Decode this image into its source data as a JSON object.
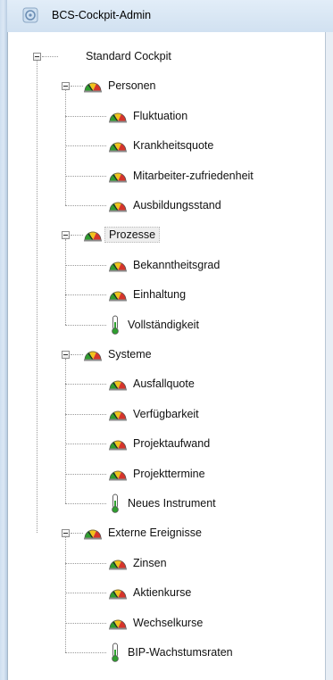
{
  "window": {
    "title": "BCS-Cockpit-Admin"
  },
  "tree": {
    "root": {
      "label": "Standard Cockpit",
      "icon": "none"
    },
    "groups": [
      {
        "label": "Personen",
        "icon": "gauge-icon",
        "items": [
          {
            "label": "Fluktuation",
            "icon": "gauge-icon"
          },
          {
            "label": "Krankheitsquote",
            "icon": "gauge-icon"
          },
          {
            "label": "Mitarbeiter-zufriedenheit",
            "icon": "gauge-icon"
          },
          {
            "label": "Ausbildungsstand",
            "icon": "gauge-icon"
          }
        ]
      },
      {
        "label": "Prozesse",
        "icon": "gauge-icon",
        "selected": true,
        "items": [
          {
            "label": "Bekanntheitsgrad",
            "icon": "gauge-icon"
          },
          {
            "label": "Einhaltung",
            "icon": "gauge-icon"
          },
          {
            "label": "Vollständigkeit",
            "icon": "thermometer-icon"
          }
        ]
      },
      {
        "label": "Systeme",
        "icon": "gauge-icon",
        "items": [
          {
            "label": "Ausfallquote",
            "icon": "gauge-icon"
          },
          {
            "label": "Verfügbarkeit",
            "icon": "gauge-icon"
          },
          {
            "label": "Projektaufwand",
            "icon": "gauge-icon"
          },
          {
            "label": "Projekttermine",
            "icon": "gauge-icon"
          },
          {
            "label": "Neues Instrument",
            "icon": "thermometer-icon"
          }
        ]
      },
      {
        "label": "Externe Ereignisse",
        "icon": "gauge-icon",
        "items": [
          {
            "label": "Zinsen",
            "icon": "gauge-icon"
          },
          {
            "label": "Aktienkurse",
            "icon": "gauge-icon"
          },
          {
            "label": "Wechselkurse",
            "icon": "gauge-icon"
          },
          {
            "label": "BIP-Wachstumsraten",
            "icon": "thermometer-icon"
          }
        ]
      }
    ]
  },
  "colors": {
    "titlebar": "#d9e7f5",
    "gauge_green": "#2e9e2e",
    "gauge_yellow": "#f2c21b",
    "gauge_red": "#d6342a",
    "thermo_green": "#2e9e2e"
  }
}
